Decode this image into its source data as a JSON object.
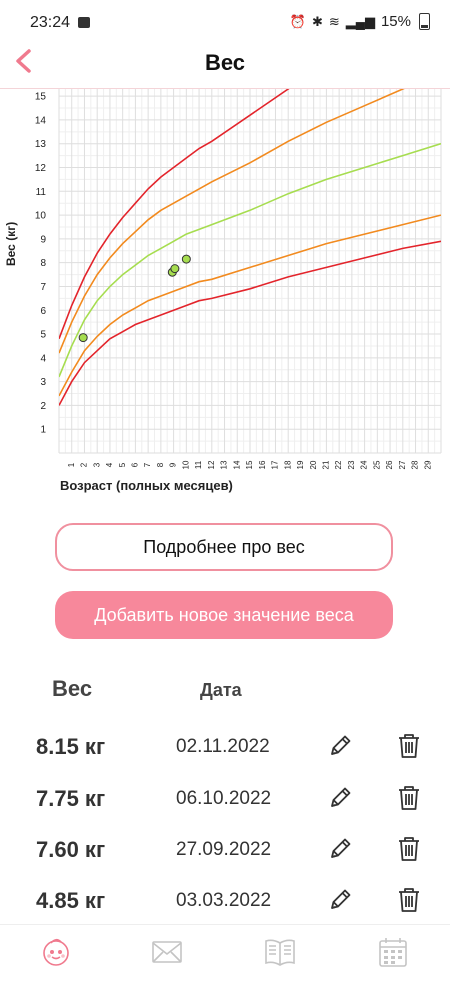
{
  "status": {
    "time": "23:24",
    "battery": "15%"
  },
  "header": {
    "title": "Вес"
  },
  "chart_data": {
    "type": "line",
    "xlabel": "Возраст (полных месяцев)",
    "ylabel": "Вес (кг)",
    "xlim": [
      0,
      30
    ],
    "ylim": [
      0,
      15.3
    ],
    "grid": true,
    "x_ticks": [
      1,
      2,
      3,
      4,
      5,
      6,
      7,
      8,
      9,
      10,
      11,
      12,
      13,
      14,
      15,
      16,
      17,
      18,
      19,
      20,
      21,
      22,
      23,
      24,
      25,
      26,
      27,
      28,
      29
    ],
    "y_ticks": [
      1,
      2,
      3,
      4,
      5,
      6,
      7,
      8,
      9,
      10,
      11,
      12,
      13,
      14,
      15
    ],
    "series": [
      {
        "color": "#e3242b",
        "x": [
          0,
          1,
          2,
          3,
          4,
          5,
          6,
          7,
          8,
          9,
          10,
          11,
          12,
          15,
          18,
          21,
          24,
          27,
          30
        ],
        "values": [
          2.0,
          3.0,
          3.8,
          4.3,
          4.8,
          5.1,
          5.4,
          5.6,
          5.8,
          6.0,
          6.2,
          6.4,
          6.5,
          6.9,
          7.4,
          7.8,
          8.2,
          8.6,
          8.9
        ]
      },
      {
        "color": "#f28a1e",
        "x": [
          0,
          1,
          2,
          3,
          4,
          5,
          6,
          7,
          8,
          9,
          10,
          11,
          12,
          15,
          18,
          21,
          24,
          27,
          30
        ],
        "values": [
          2.4,
          3.4,
          4.3,
          4.9,
          5.4,
          5.8,
          6.1,
          6.4,
          6.6,
          6.8,
          7.0,
          7.2,
          7.3,
          7.8,
          8.3,
          8.8,
          9.2,
          9.6,
          10.0
        ]
      },
      {
        "color": "#a6dd4f",
        "x": [
          0,
          1,
          2,
          3,
          4,
          5,
          6,
          7,
          8,
          9,
          10,
          11,
          12,
          15,
          18,
          21,
          24,
          27,
          30
        ],
        "values": [
          3.2,
          4.5,
          5.6,
          6.4,
          7.0,
          7.5,
          7.9,
          8.3,
          8.6,
          8.9,
          9.2,
          9.4,
          9.6,
          10.2,
          10.9,
          11.5,
          12.0,
          12.5,
          13.0
        ]
      },
      {
        "color": "#f28a1e",
        "x": [
          0,
          1,
          2,
          3,
          4,
          5,
          6,
          7,
          8,
          9,
          10,
          11,
          12,
          15,
          18,
          21,
          24,
          27,
          30
        ],
        "values": [
          4.2,
          5.5,
          6.6,
          7.5,
          8.2,
          8.8,
          9.3,
          9.8,
          10.2,
          10.5,
          10.8,
          11.1,
          11.4,
          12.2,
          13.1,
          13.9,
          14.6,
          15.3,
          16.0
        ]
      },
      {
        "color": "#e3242b",
        "x": [
          0,
          1,
          2,
          3,
          4,
          5,
          6,
          7,
          8,
          9,
          10,
          11,
          12,
          15,
          18,
          21,
          24,
          27,
          30
        ],
        "values": [
          4.8,
          6.2,
          7.4,
          8.4,
          9.2,
          9.9,
          10.5,
          11.1,
          11.6,
          12.0,
          12.4,
          12.8,
          13.1,
          14.2,
          15.3,
          16.4,
          17.4,
          18.4,
          19.4
        ]
      }
    ],
    "points": [
      {
        "x": 1.9,
        "y": 4.85
      },
      {
        "x": 8.9,
        "y": 7.6
      },
      {
        "x": 9.1,
        "y": 7.75
      },
      {
        "x": 10.0,
        "y": 8.15
      }
    ],
    "point_color": "#a6dd4f"
  },
  "buttons": {
    "details": "Подробнее про вес",
    "add": "Добавить новое значение веса"
  },
  "table": {
    "headers": {
      "weight": "Вес",
      "date": "Дата"
    },
    "rows": [
      {
        "weight": "8.15 кг",
        "date": "02.11.2022"
      },
      {
        "weight": "7.75 кг",
        "date": "06.10.2022"
      },
      {
        "weight": "7.60 кг",
        "date": "27.09.2022"
      },
      {
        "weight": "4.85 кг",
        "date": "03.03.2022"
      }
    ]
  },
  "colors": {
    "accent": "#f7889b",
    "accent_border": "#f0909f",
    "nav_inactive": "#c4c4c4"
  },
  "icons": {
    "back": "chevron-left-icon",
    "edit": "pencil-icon",
    "delete": "trash-icon",
    "nav": [
      "baby-face-icon",
      "mail-icon",
      "book-icon",
      "calendar-icon"
    ]
  }
}
